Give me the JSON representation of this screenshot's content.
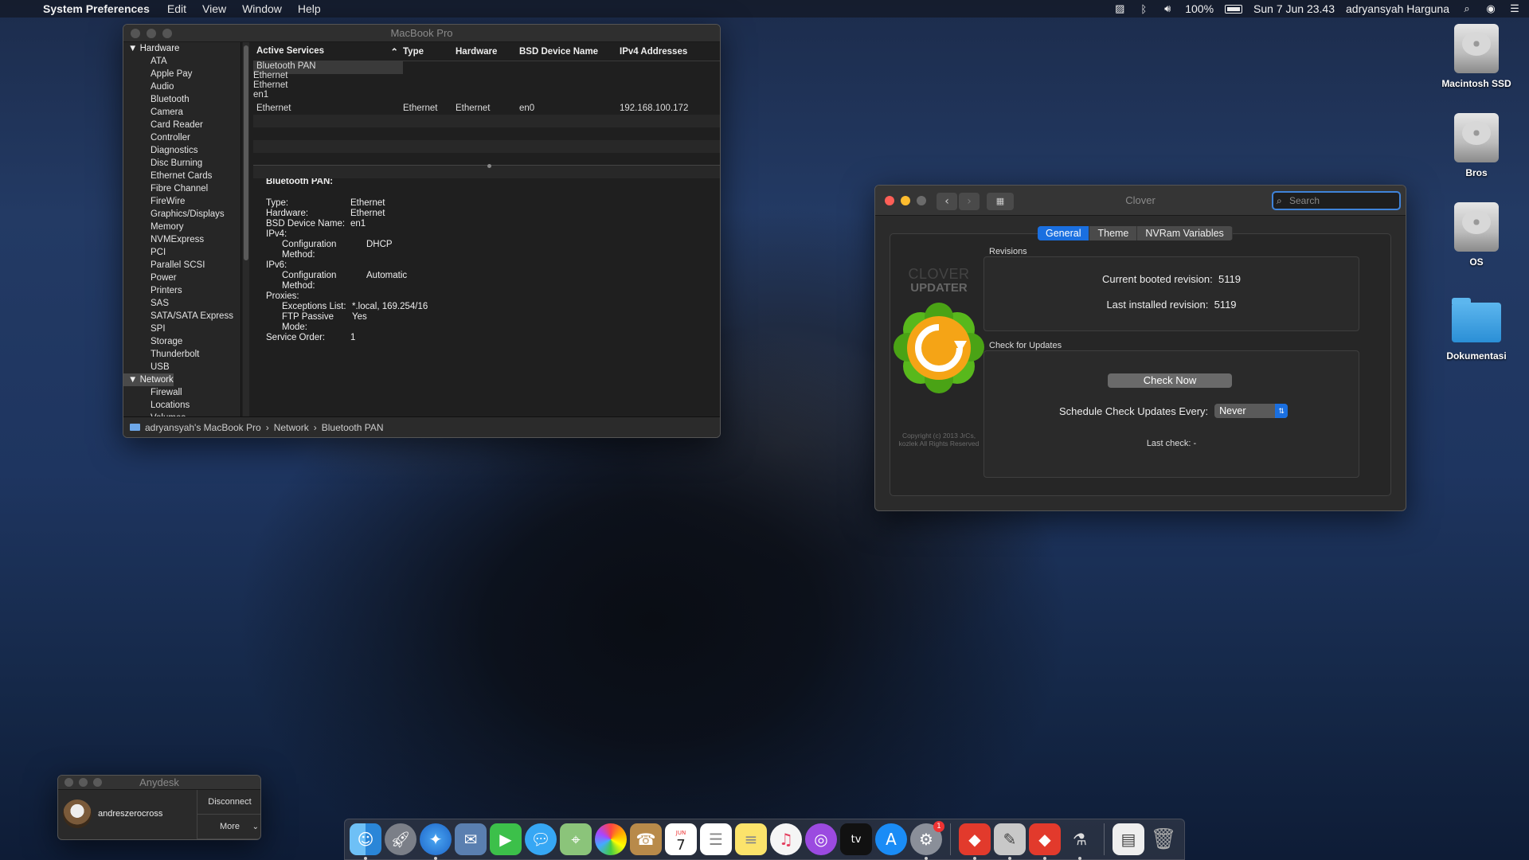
{
  "menubar": {
    "app": "System Preferences",
    "items": [
      "Edit",
      "View",
      "Window",
      "Help"
    ],
    "battery": "100%",
    "datetime": "Sun 7 Jun  23.43",
    "user": "adryansyah Harguna"
  },
  "sysinfo": {
    "title": "MacBook Pro",
    "sidebar": {
      "hardware_header": "Hardware",
      "hardware_items": [
        "ATA",
        "Apple Pay",
        "Audio",
        "Bluetooth",
        "Camera",
        "Card Reader",
        "Controller",
        "Diagnostics",
        "Disc Burning",
        "Ethernet Cards",
        "Fibre Channel",
        "FireWire",
        "Graphics/Displays",
        "Memory",
        "NVMExpress",
        "PCI",
        "Parallel SCSI",
        "Power",
        "Printers",
        "SAS",
        "SATA/SATA Express",
        "SPI",
        "Storage",
        "Thunderbolt",
        "USB"
      ],
      "network_header": "Network",
      "network_items": [
        "Firewall",
        "Locations",
        "Volumes"
      ]
    },
    "table": {
      "headers": [
        "Active Services",
        "Type",
        "Hardware",
        "BSD Device Name",
        "IPv4 Addresses"
      ],
      "rows": [
        [
          "Bluetooth PAN",
          "Ethernet",
          "Ethernet",
          "en1",
          ""
        ],
        [
          "Ethernet",
          "Ethernet",
          "Ethernet",
          "en0",
          "192.168.100.172"
        ]
      ]
    },
    "detail": {
      "title": "Bluetooth PAN:",
      "type_k": "Type:",
      "type_v": "Ethernet",
      "hw_k": "Hardware:",
      "hw_v": "Ethernet",
      "bsd_k": "BSD Device Name:",
      "bsd_v": "en1",
      "ipv4_k": "IPv4:",
      "ipv4_cm_k": "Configuration Method:",
      "ipv4_cm_v": "DHCP",
      "ipv6_k": "IPv6:",
      "ipv6_cm_k": "Configuration Method:",
      "ipv6_cm_v": "Automatic",
      "proxies_k": "Proxies:",
      "exc_k": "Exceptions List:",
      "exc_v": "*.local, 169.254/16",
      "ftp_k": "FTP Passive Mode:",
      "ftp_v": "Yes",
      "order_k": "Service Order:",
      "order_v": "1"
    },
    "path": [
      "adryansyah's MacBook Pro",
      "Network",
      "Bluetooth PAN"
    ]
  },
  "clover": {
    "title": "Clover",
    "search_placeholder": "Search",
    "tabs": [
      "General",
      "Theme",
      "NVRam Variables"
    ],
    "logo_line1": "CLOVER",
    "logo_line2": "UPDATER",
    "copyright": "Copyright (c) 2013 JrCs, kozlek All Rights Reserved",
    "revisions_label": "Revisions",
    "current_label": "Current booted revision:",
    "current_value": "5119",
    "installed_label": "Last installed revision:",
    "installed_value": "5119",
    "updates_label": "Check for Updates",
    "check_now": "Check Now",
    "schedule_label": "Schedule Check Updates Every:",
    "schedule_value": "Never",
    "last_check": "Last check: -"
  },
  "anydesk": {
    "title": "Anydesk",
    "user": "andreszerocross",
    "disconnect": "Disconnect",
    "more": "More"
  },
  "desktop": {
    "icons": [
      "Macintosh SSD",
      "Bros",
      "OS",
      "Dokumentasi"
    ]
  },
  "dock": {
    "calendar_month": "JUN",
    "calendar_day": "7",
    "tv_label": "tv",
    "prefs_badge": "1"
  }
}
